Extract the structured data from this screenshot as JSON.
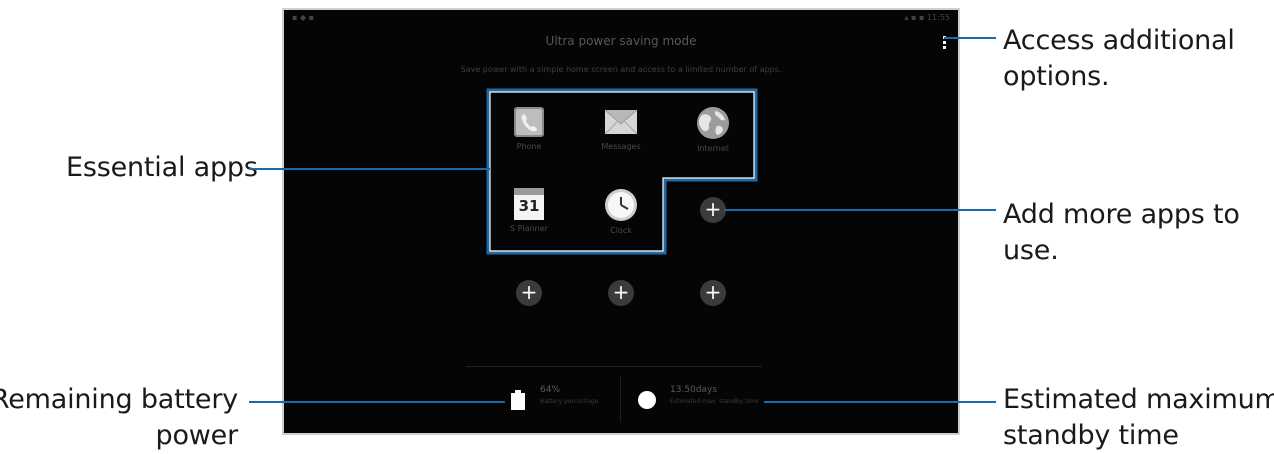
{
  "callouts": {
    "essential_apps": "Essential apps",
    "access_line1": "Access additional",
    "access_line2": "options.",
    "add_line1": "Add more apps to",
    "add_line2": "use.",
    "battery_line1": "Remaining battery",
    "battery_line2": "power",
    "standby_line1": "Estimated maximum",
    "standby_line2": "standby time"
  },
  "screen": {
    "status_left": "▪ ◆ ▪",
    "status_right": "▴ ▪ ▪ 11:55",
    "title": "Ultra power saving mode",
    "subtitle": "Save power with a simple home screen and access to a limited number of apps.",
    "apps": [
      {
        "label": "Phone",
        "icon": "phone-icon"
      },
      {
        "label": "Messages",
        "icon": "messages-icon"
      },
      {
        "label": "Internet",
        "icon": "globe-icon"
      },
      {
        "label": "S Planner",
        "icon": "calendar-icon",
        "badge": "31"
      },
      {
        "label": "Clock",
        "icon": "clock-icon"
      }
    ],
    "battery_value": "64%",
    "battery_sub": "Battery percentage",
    "standby_value": "13.50days",
    "standby_sub": "Estimated max. standby time"
  },
  "colors": {
    "callout_line": "#1e6aa8",
    "screen_bg": "#050505"
  }
}
